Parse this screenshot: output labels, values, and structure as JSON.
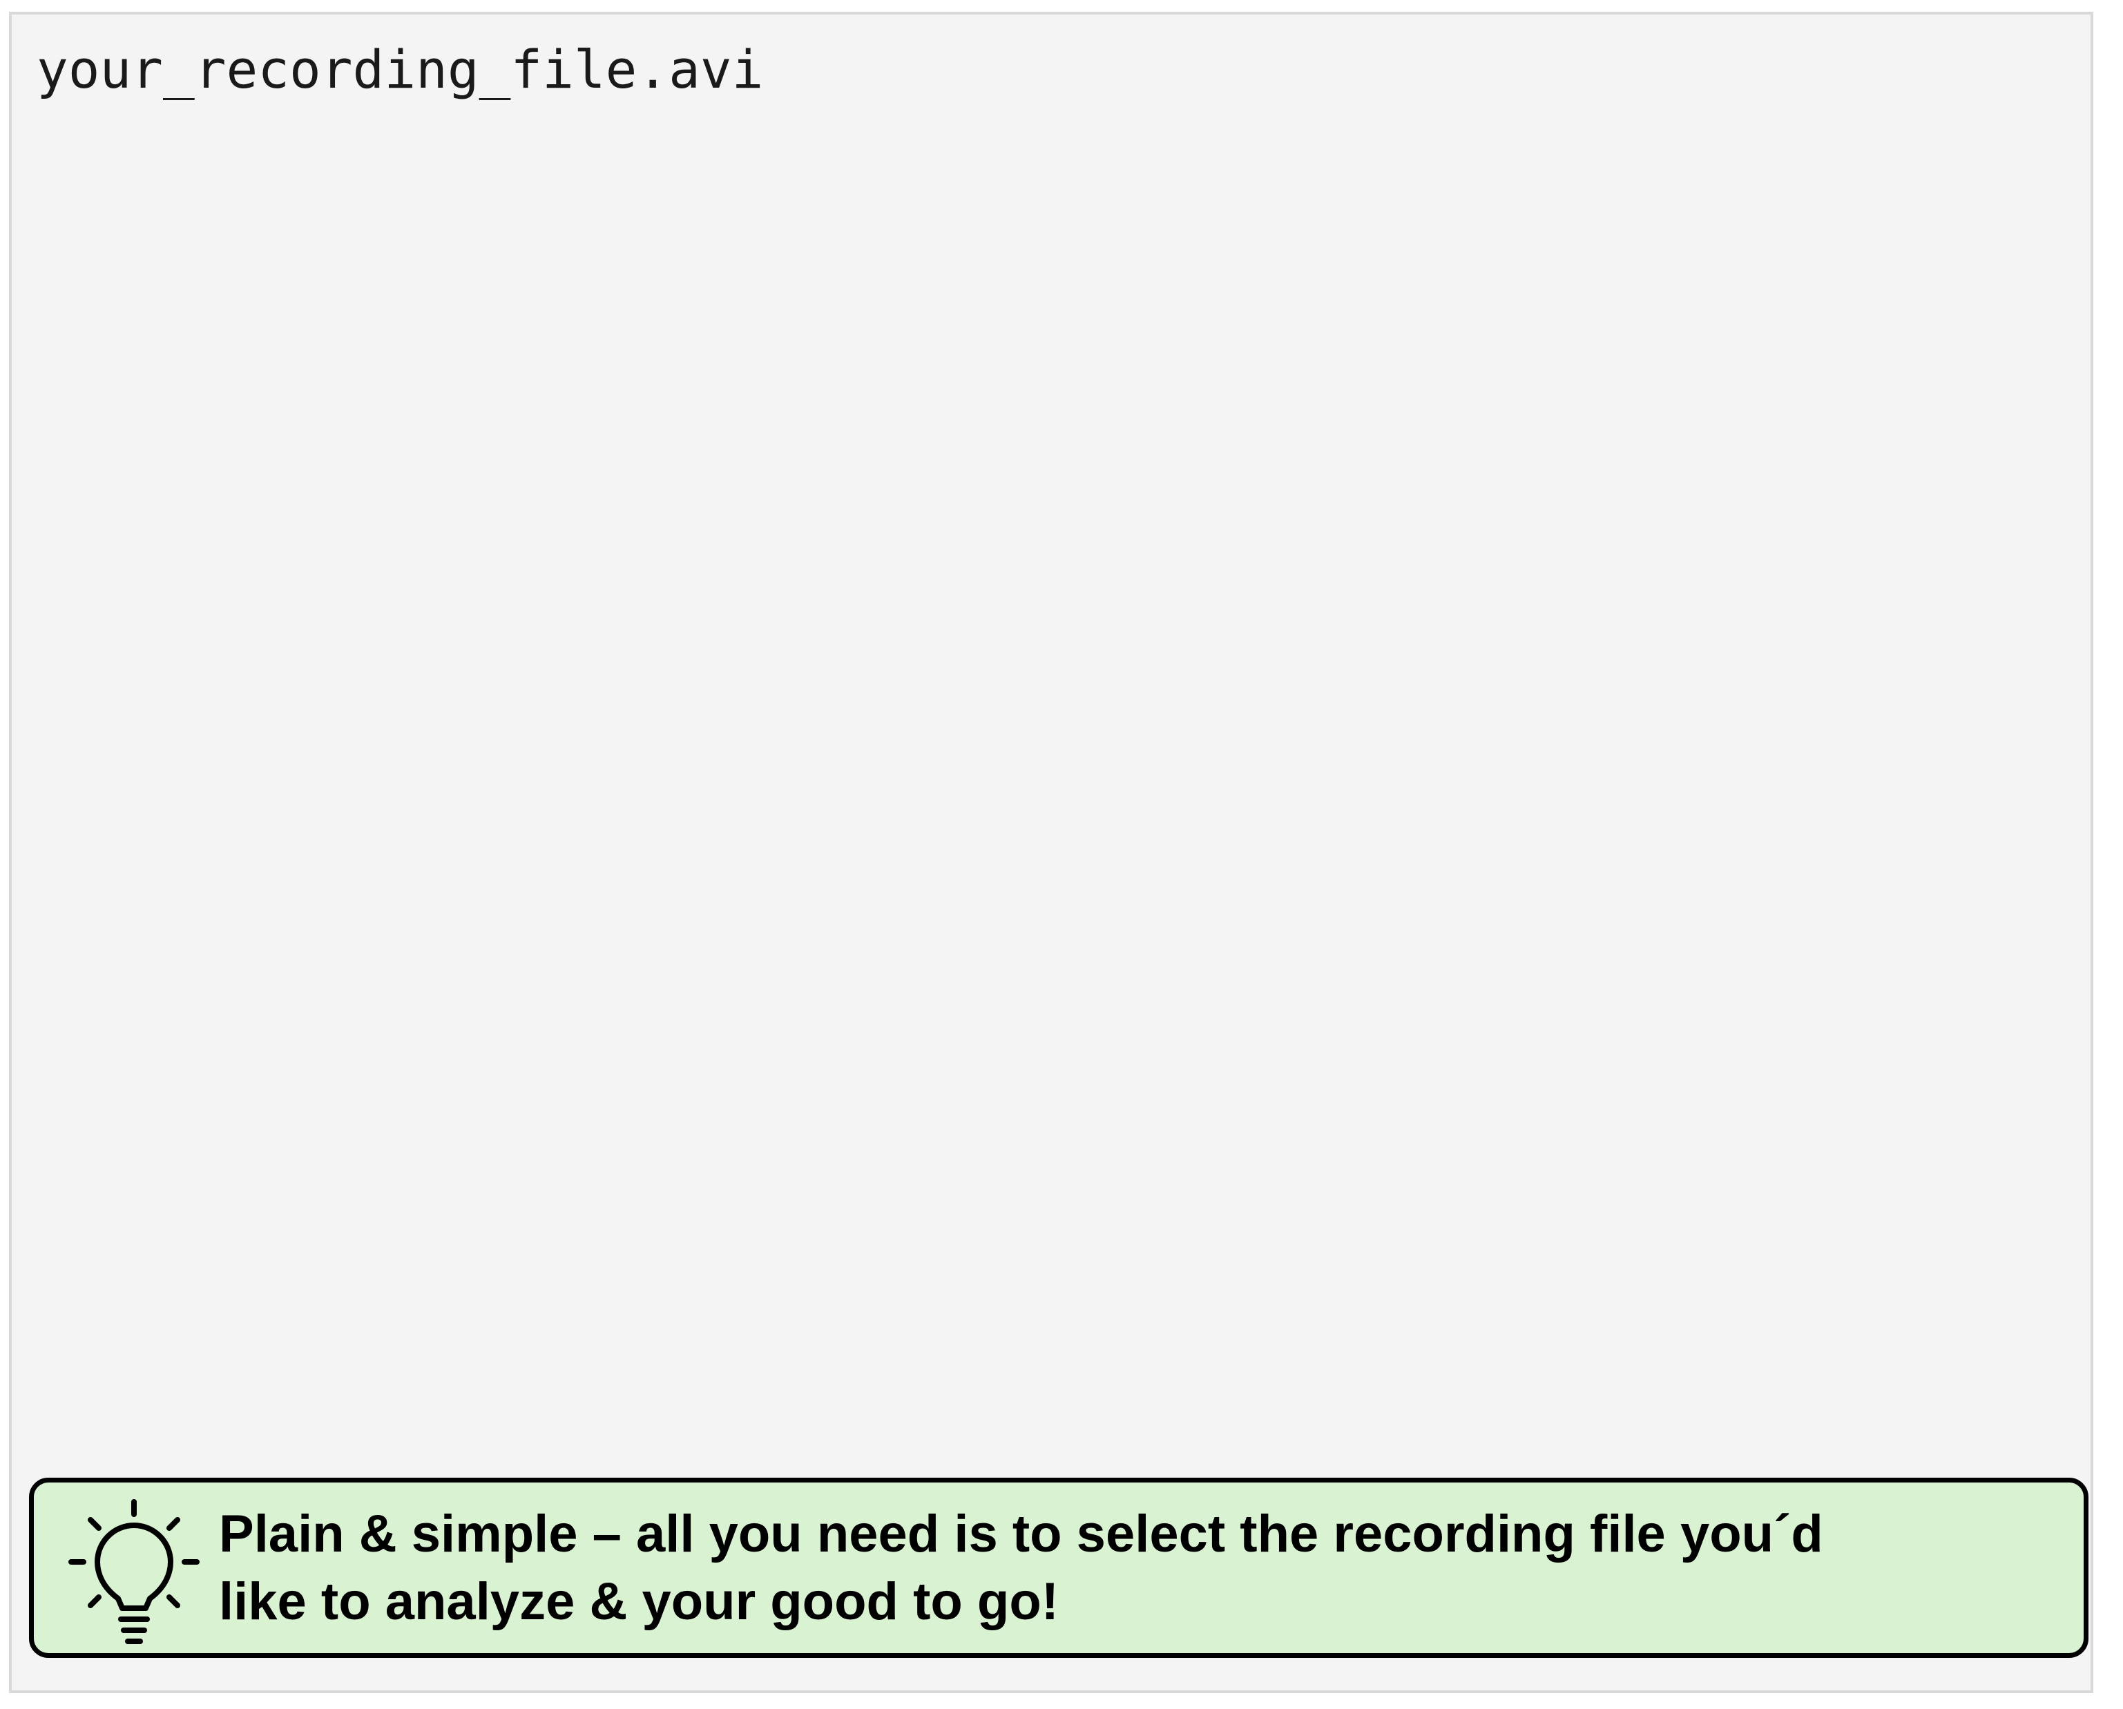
{
  "panel": {
    "filename": "your_recording_file.avi"
  },
  "tip": {
    "icon": "lightbulb-icon",
    "line1": "Plain & simple – all you need is to select the recording file you´d",
    "line2": "like to analyze & your good to go!"
  },
  "colors": {
    "panel_background": "#f4f4f4",
    "tip_background": "#d9f2d1",
    "tip_border": "#000000"
  }
}
